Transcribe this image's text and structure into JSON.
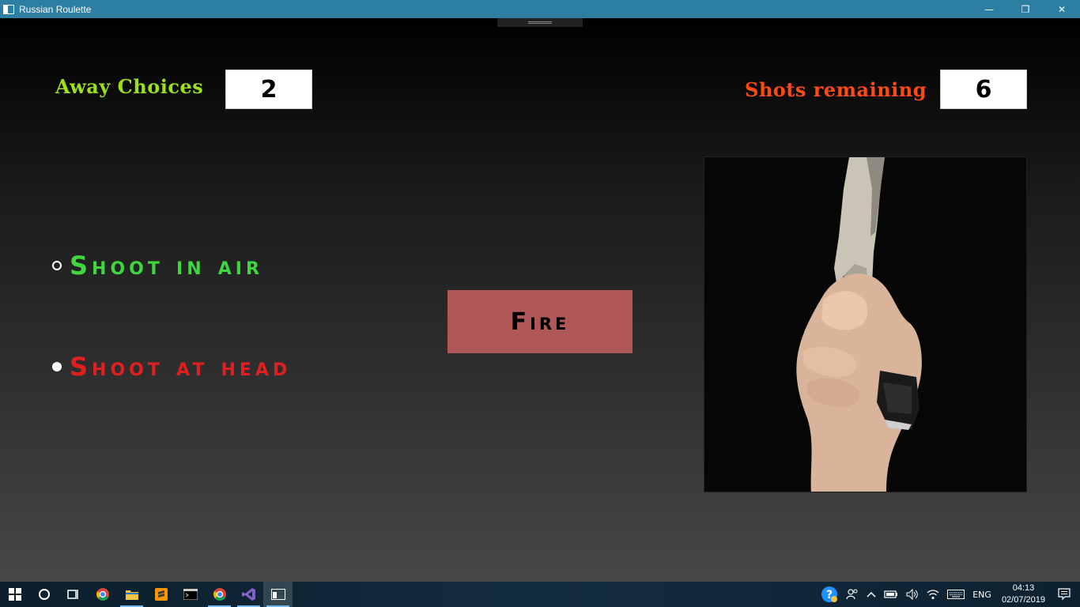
{
  "window": {
    "title": "Russian Roulette",
    "minimize_glyph": "—",
    "restore_glyph": "❐",
    "close_glyph": "✕"
  },
  "game": {
    "away_label": "Away Choices",
    "away_value": "2",
    "shots_label": "Shots remaining",
    "shots_value": "6",
    "options": [
      {
        "label": "Shoot in air",
        "selected": false,
        "color": "#3fd63f"
      },
      {
        "label": "Shoot at head",
        "selected": true,
        "color": "#e02020"
      }
    ],
    "fire_label": "Fire",
    "fire_color": "#b05858",
    "image_subject": "hand-holding-pistol"
  },
  "taskbar": {
    "apps": [
      "start-icon",
      "search-icon",
      "task-view-icon",
      "chrome-icon",
      "file-explorer-icon",
      "sublime-text-icon",
      "command-prompt-icon",
      "chrome-icon",
      "visual-studio-icon",
      "app-window-icon"
    ],
    "language": "ENG",
    "time": "04:13",
    "date": "02/07/2019"
  }
}
